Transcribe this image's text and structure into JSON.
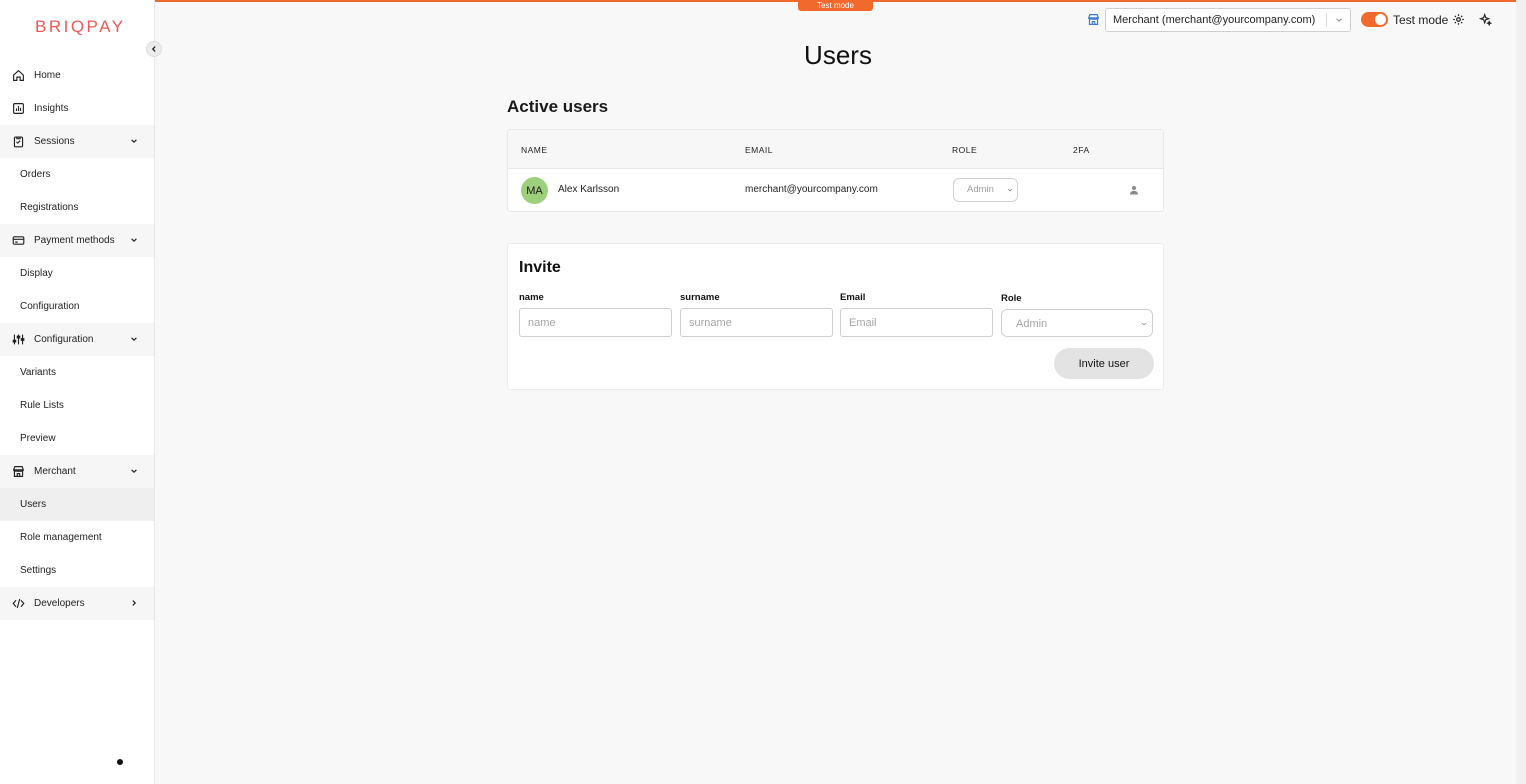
{
  "brand": {
    "logo_text": "BRIQPAY",
    "logo_color": "#e85a5a",
    "accent_color": "#f2692e"
  },
  "sidebar": {
    "items": [
      {
        "label": "Home",
        "icon": "home-icon"
      },
      {
        "label": "Insights",
        "icon": "chart-icon"
      },
      {
        "label": "Sessions",
        "icon": "clipboard-icon"
      },
      {
        "label": "Orders"
      },
      {
        "label": "Registrations"
      },
      {
        "label": "Payment methods",
        "icon": "card-icon"
      },
      {
        "label": "Display"
      },
      {
        "label": "Configuration"
      },
      {
        "label": "Configuration",
        "icon": "sliders-icon"
      },
      {
        "label": "Variants"
      },
      {
        "label": "Rule Lists"
      },
      {
        "label": "Preview"
      },
      {
        "label": "Merchant",
        "icon": "store-icon"
      },
      {
        "label": "Users",
        "active": true
      },
      {
        "label": "Role management"
      },
      {
        "label": "Settings"
      },
      {
        "label": "Developers",
        "icon": "code-icon"
      }
    ]
  },
  "topbar": {
    "test_badge": "Test mode",
    "merchant_select": "Merchant (merchant@yourcompany.com)",
    "test_mode_label": "Test mode",
    "test_mode_on": true
  },
  "page": {
    "title": "Users",
    "active_users_title": "Active users",
    "table": {
      "headers": [
        "NAME",
        "EMAIL",
        "ROLE",
        "2FA"
      ],
      "rows": [
        {
          "initials": "MA",
          "name": "Alex Karlsson",
          "email": "merchant@yourcompany.com",
          "role": "Admin"
        }
      ]
    },
    "invite": {
      "title": "Invite",
      "name_label": "name",
      "name_placeholder": "name",
      "surname_label": "surname",
      "surname_placeholder": "surname",
      "email_label": "Email",
      "email_placeholder": "Email",
      "role_label": "Role",
      "role_value": "Admin",
      "button_label": "Invite user"
    }
  }
}
